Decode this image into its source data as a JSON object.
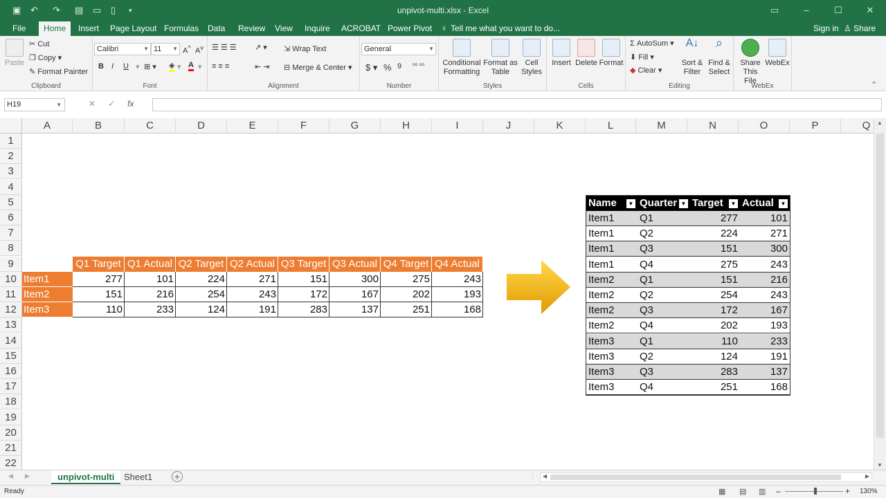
{
  "window": {
    "title": "unpivot-multi.xlsx - Excel",
    "signin": "Sign in",
    "share": "Share"
  },
  "tabs": [
    "File",
    "Home",
    "Insert",
    "Page Layout",
    "Formulas",
    "Data",
    "Review",
    "View",
    "Inquire",
    "ACROBAT",
    "Power Pivot"
  ],
  "tell_me": "Tell me what you want to do...",
  "ribbon": {
    "clipboard": {
      "label": "Clipboard",
      "paste": "Paste",
      "cut": "Cut",
      "copy": "Copy",
      "format_painter": "Format Painter"
    },
    "font": {
      "label": "Font",
      "name": "Calibri",
      "size": "11",
      "bold": "B",
      "italic": "I",
      "underline": "U"
    },
    "alignment": {
      "label": "Alignment",
      "wrap": "Wrap Text",
      "merge": "Merge & Center"
    },
    "number": {
      "label": "Number",
      "format": "General",
      "currency": "$",
      "percent": "%",
      "comma": "9"
    },
    "styles": {
      "label": "Styles",
      "conditional": [
        "Conditional",
        "Formatting"
      ],
      "format_table": [
        "Format as",
        "Table"
      ],
      "cell_styles": [
        "Cell",
        "Styles"
      ]
    },
    "cells": {
      "label": "Cells",
      "insert": "Insert",
      "delete": "Delete",
      "format": "Format"
    },
    "editing": {
      "label": "Editing",
      "autosum": "AutoSum",
      "fill": "Fill",
      "clear": "Clear",
      "sort": [
        "Sort &",
        "Filter"
      ],
      "find": [
        "Find &",
        "Select"
      ]
    },
    "webex": {
      "label": "WebEx",
      "share": [
        "Share",
        "This File"
      ],
      "webex": "WebEx"
    }
  },
  "formula_bar": {
    "name_box": "H19",
    "fx": "fx",
    "value": ""
  },
  "columns": [
    "A",
    "B",
    "C",
    "D",
    "E",
    "F",
    "G",
    "H",
    "I",
    "J",
    "K",
    "L",
    "M",
    "N",
    "O",
    "P",
    "Q"
  ],
  "rows": [
    "1",
    "2",
    "3",
    "4",
    "5",
    "6",
    "7",
    "8",
    "9",
    "10",
    "11",
    "12",
    "13",
    "14",
    "15",
    "16",
    "17",
    "18",
    "19",
    "20",
    "21",
    "22"
  ],
  "source": {
    "headers": [
      "Q1 Target",
      "Q1 Actual",
      "Q2 Target",
      "Q2 Actual",
      "Q3 Target",
      "Q3 Actual",
      "Q4 Target",
      "Q4 Actual"
    ],
    "items": [
      {
        "name": "Item1",
        "values": [
          "277",
          "101",
          "224",
          "271",
          "151",
          "300",
          "275",
          "243"
        ]
      },
      {
        "name": "Item2",
        "values": [
          "151",
          "216",
          "254",
          "243",
          "172",
          "167",
          "202",
          "193"
        ]
      },
      {
        "name": "Item3",
        "values": [
          "110",
          "233",
          "124",
          "191",
          "283",
          "137",
          "251",
          "168"
        ]
      }
    ]
  },
  "result": {
    "headers": [
      "Name",
      "Quarter",
      "Target",
      "Actual"
    ],
    "rows": [
      [
        "Item1",
        "Q1",
        "277",
        "101"
      ],
      [
        "Item1",
        "Q2",
        "224",
        "271"
      ],
      [
        "Item1",
        "Q3",
        "151",
        "300"
      ],
      [
        "Item1",
        "Q4",
        "275",
        "243"
      ],
      [
        "Item2",
        "Q1",
        "151",
        "216"
      ],
      [
        "Item2",
        "Q2",
        "254",
        "243"
      ],
      [
        "Item2",
        "Q3",
        "172",
        "167"
      ],
      [
        "Item2",
        "Q4",
        "202",
        "193"
      ],
      [
        "Item3",
        "Q1",
        "110",
        "233"
      ],
      [
        "Item3",
        "Q2",
        "124",
        "191"
      ],
      [
        "Item3",
        "Q3",
        "283",
        "137"
      ],
      [
        "Item3",
        "Q4",
        "251",
        "168"
      ]
    ]
  },
  "sheets": [
    {
      "name": "unpivot-multi",
      "active": true
    },
    {
      "name": "Sheet1",
      "active": false
    }
  ],
  "status": {
    "ready": "Ready",
    "zoom": "130%"
  },
  "colors": {
    "excel_green": "#217346",
    "orange": "#ed7d31",
    "band": "#d9d9d9",
    "arrow": "#f5b400"
  }
}
